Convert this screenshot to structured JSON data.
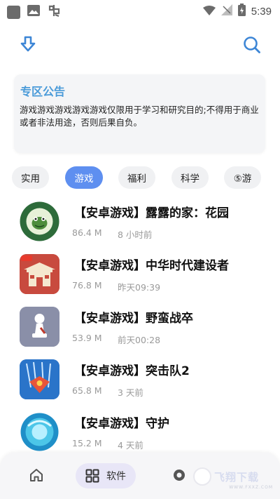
{
  "status_bar": {
    "time": "5:39",
    "icons": [
      "app-square-icon",
      "image-icon",
      "bug-icon",
      "wifi-icon",
      "no-signal-icon",
      "battery-charging-icon"
    ]
  },
  "header": {
    "download_icon": "download-icon",
    "search_icon": "search-icon"
  },
  "notice": {
    "title": "专区公告",
    "body": "游戏游戏游戏游戏游戏仅限用于学习和研究目的;不得用于商业或者非法用途，否则后果自负。"
  },
  "tabs": [
    {
      "label": "实用",
      "active": false
    },
    {
      "label": "游戏",
      "active": true
    },
    {
      "label": "福利",
      "active": false
    },
    {
      "label": "科学",
      "active": false
    },
    {
      "label": "⑤游",
      "active": false
    }
  ],
  "apps": [
    {
      "title": "【安卓游戏】露露的家：花园",
      "size": "86.4 M",
      "time": "8 小时前",
      "icon": "plant-flowers-icon"
    },
    {
      "title": "【安卓游戏】中华时代建设者",
      "size": "76.8 M",
      "time": "昨天09:39",
      "icon": "palace-icon"
    },
    {
      "title": "【安卓游戏】野蛮战卒",
      "size": "53.9 M",
      "time": "前天00:28",
      "icon": "pawn-icon"
    },
    {
      "title": "【安卓游戏】突击队2",
      "size": "65.8 M",
      "time": "3 天前",
      "icon": "rocket-icon"
    },
    {
      "title": "【安卓游戏】守护",
      "size": "15.2 M",
      "time": "4 天前",
      "icon": "magic-orb-icon"
    }
  ],
  "bottom_nav": {
    "software_label": "软件",
    "watermark_text": "飞翔下载",
    "watermark_sub": "WWW.FXXZ.COM"
  },
  "colors": {
    "accent": "#5e8ff0",
    "notice_title": "#4a9bd9",
    "muted_text": "#9a9a9a"
  }
}
